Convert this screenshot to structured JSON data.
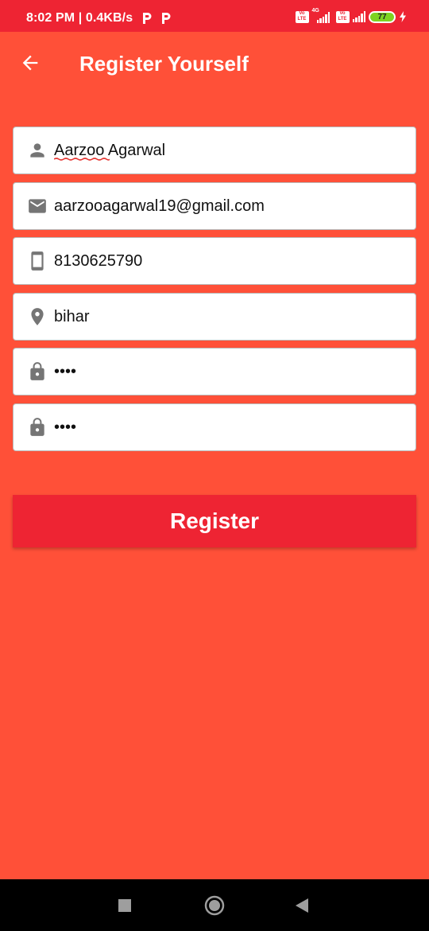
{
  "status_bar": {
    "time_speed": "8:02 PM | 0.4KB/s",
    "volte_label": "Vo LTE",
    "network_type": "4G",
    "battery_level": "77",
    "background_color": "#ee2433"
  },
  "app_bar": {
    "title": "Register Yourself",
    "back_icon": "arrow-left-icon"
  },
  "form": {
    "name": {
      "icon": "person-icon",
      "value": "Aarzoo Agarwal"
    },
    "email": {
      "icon": "mail-icon",
      "value": "aarzooagarwal19@gmail.com"
    },
    "phone": {
      "icon": "smartphone-icon",
      "value": "8130625790"
    },
    "location": {
      "icon": "location-pin-icon",
      "value": "bihar"
    },
    "password": {
      "icon": "lock-icon",
      "value": "••••"
    },
    "confirm_password": {
      "icon": "lock-icon",
      "value": "••••"
    }
  },
  "register_button": {
    "label": "Register",
    "color": "#ee2433"
  },
  "page_background": "#ff5038",
  "nav_bar": {
    "recents_icon": "square-icon",
    "home_icon": "circle-icon",
    "back_icon": "triangle-back-icon"
  }
}
